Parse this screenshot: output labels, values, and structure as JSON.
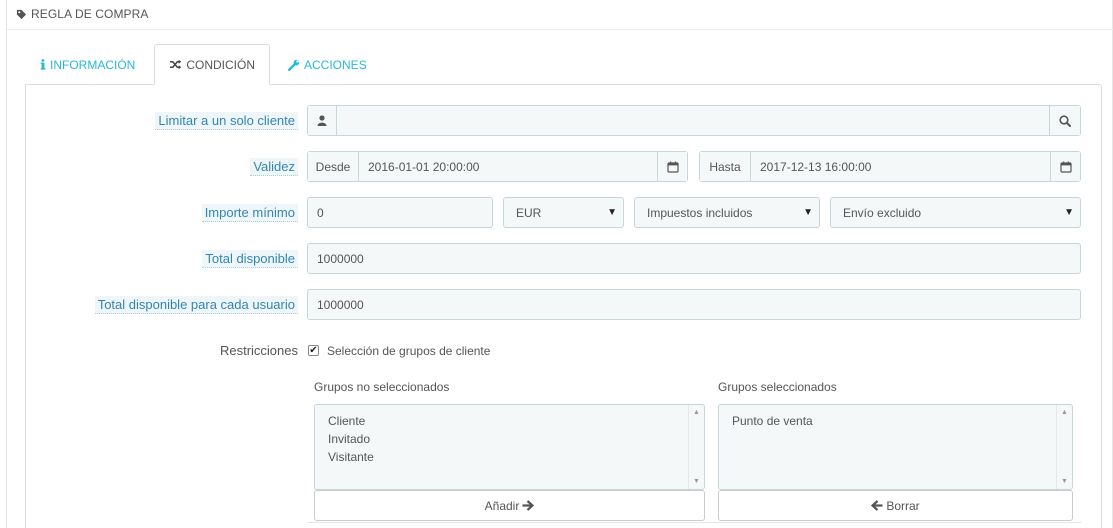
{
  "panel": {
    "title": "REGLA DE COMPRA",
    "title_icon": "tag-icon"
  },
  "tabs": [
    {
      "label": "INFORMACIÓN",
      "icon": "info-icon",
      "active": false
    },
    {
      "label": "CONDICIÓN",
      "icon": "shuffle-icon",
      "active": true
    },
    {
      "label": "ACCIONES",
      "icon": "wrench-icon",
      "active": false
    }
  ],
  "form": {
    "customer": {
      "label": "Limitar a un solo cliente",
      "value": "",
      "left_icon": "user-icon",
      "right_icon": "search-icon"
    },
    "validity": {
      "label": "Validez",
      "from_addon": "Desde",
      "from_value": "2016-01-01 20:00:00",
      "to_addon": "Hasta",
      "to_value": "2017-12-13 16:00:00",
      "calendar_icon": "calendar-icon"
    },
    "minimum": {
      "label": "Importe mínimo",
      "value": "0",
      "currency": "EUR",
      "tax": "Impuestos incluidos",
      "shipping": "Envío excluido"
    },
    "total_available": {
      "label": "Total disponible",
      "value": "1000000"
    },
    "total_per_user": {
      "label": "Total disponible para cada usuario",
      "value": "1000000"
    },
    "restrictions": {
      "label": "Restricciones",
      "checkbox_checked": true,
      "checkbox_label": "Selección de grupos de cliente",
      "unselected_title": "Grupos no seleccionados",
      "unselected": [
        "Cliente",
        "Invitado",
        "Visitante"
      ],
      "selected_title": "Grupos seleccionados",
      "selected": [
        "Punto de venta"
      ],
      "add_button": "Añadir",
      "remove_button": "Borrar"
    }
  },
  "colors": {
    "accent": "#25b9d7",
    "hint_text": "#3586ae",
    "input_bg": "#f5f8f9",
    "input_border": "#c7d6db"
  }
}
